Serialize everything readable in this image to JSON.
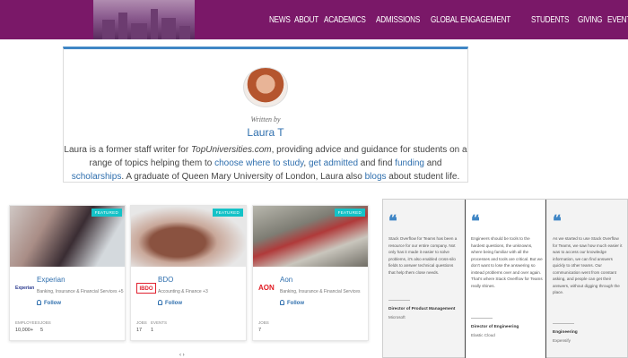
{
  "nav": {
    "items": [
      "NEWS",
      "ABOUT",
      "ACADEMICS",
      "ADMISSIONS",
      "GLOBAL ENGAGEMENT",
      "STUDENTS",
      "GIVING",
      "EVENTS"
    ]
  },
  "author": {
    "written_by": "Written by",
    "name": "Laura T",
    "bio": {
      "p1": "Laura is a former staff writer for ",
      "site": "TopUniversities.com",
      "p2": ", providing advice and guidance for students on a range of topics helping them to ",
      "link1": "choose where to study",
      "p3": ", ",
      "link2": "get admitted",
      "p4": " and find ",
      "link3": "funding",
      "p5": " and ",
      "link4": "scholarships",
      "p6": ". A graduate of Queen Mary University of London, Laura also ",
      "link5": "blogs",
      "p7": " about student life."
    }
  },
  "employers": [
    {
      "badge": "FEATURED",
      "logo": "Experian",
      "name": "Experian",
      "industry": "Banking, Insurance & Financial Services +5",
      "follow": "Follow",
      "stats": [
        {
          "label": "EMPLOYEES",
          "value": "10,000+"
        },
        {
          "label": "JOBS",
          "value": "5"
        }
      ]
    },
    {
      "badge": "FEATURED",
      "logo": "IBDO",
      "name": "BDO",
      "industry": "Accounting & Finance +3",
      "follow": "Follow",
      "stats": [
        {
          "label": "JOBS",
          "value": "17"
        },
        {
          "label": "EVENTS",
          "value": "1"
        }
      ]
    },
    {
      "badge": "FEATURED",
      "logo": "AON",
      "name": "Aon",
      "industry": "Banking, Insurance & Financial Services",
      "follow": "Follow",
      "stats": [
        {
          "label": "JOBS",
          "value": "7"
        }
      ]
    }
  ],
  "testimonials": [
    {
      "text": "Stack Overflow for Teams has been a resource for our entire company. Not only has it made it easier to solve problems, it's also enabled cross-silo fields to answer technical questions that help them close needs.",
      "role": "Director of Product Management",
      "company": "Microsoft"
    },
    {
      "text": "Engineers should be tools to the hardest questions, the unknowns, where being familiar with all the processes and tools are critical. But we don't want to lose the answering so instead problems over and over again. That's where Stack Overflow for Teams really shines.",
      "role": "Director of Engineering",
      "company": "Elastic Cloud"
    },
    {
      "text": "As we started to use Stack Overflow for Teams, we saw how much easier it was to access our knowledge information, we can find answers quickly to other teams. Our communication went from constant asking, and people can get their answers, without digging through the place.",
      "role": "Engineering",
      "company": "Expensify"
    }
  ],
  "pagination": "‹  ›",
  "colors": {
    "header": "#7a1868",
    "link": "#2f6fae",
    "badge": "#14c2c7",
    "quote": "#3f86c5"
  }
}
